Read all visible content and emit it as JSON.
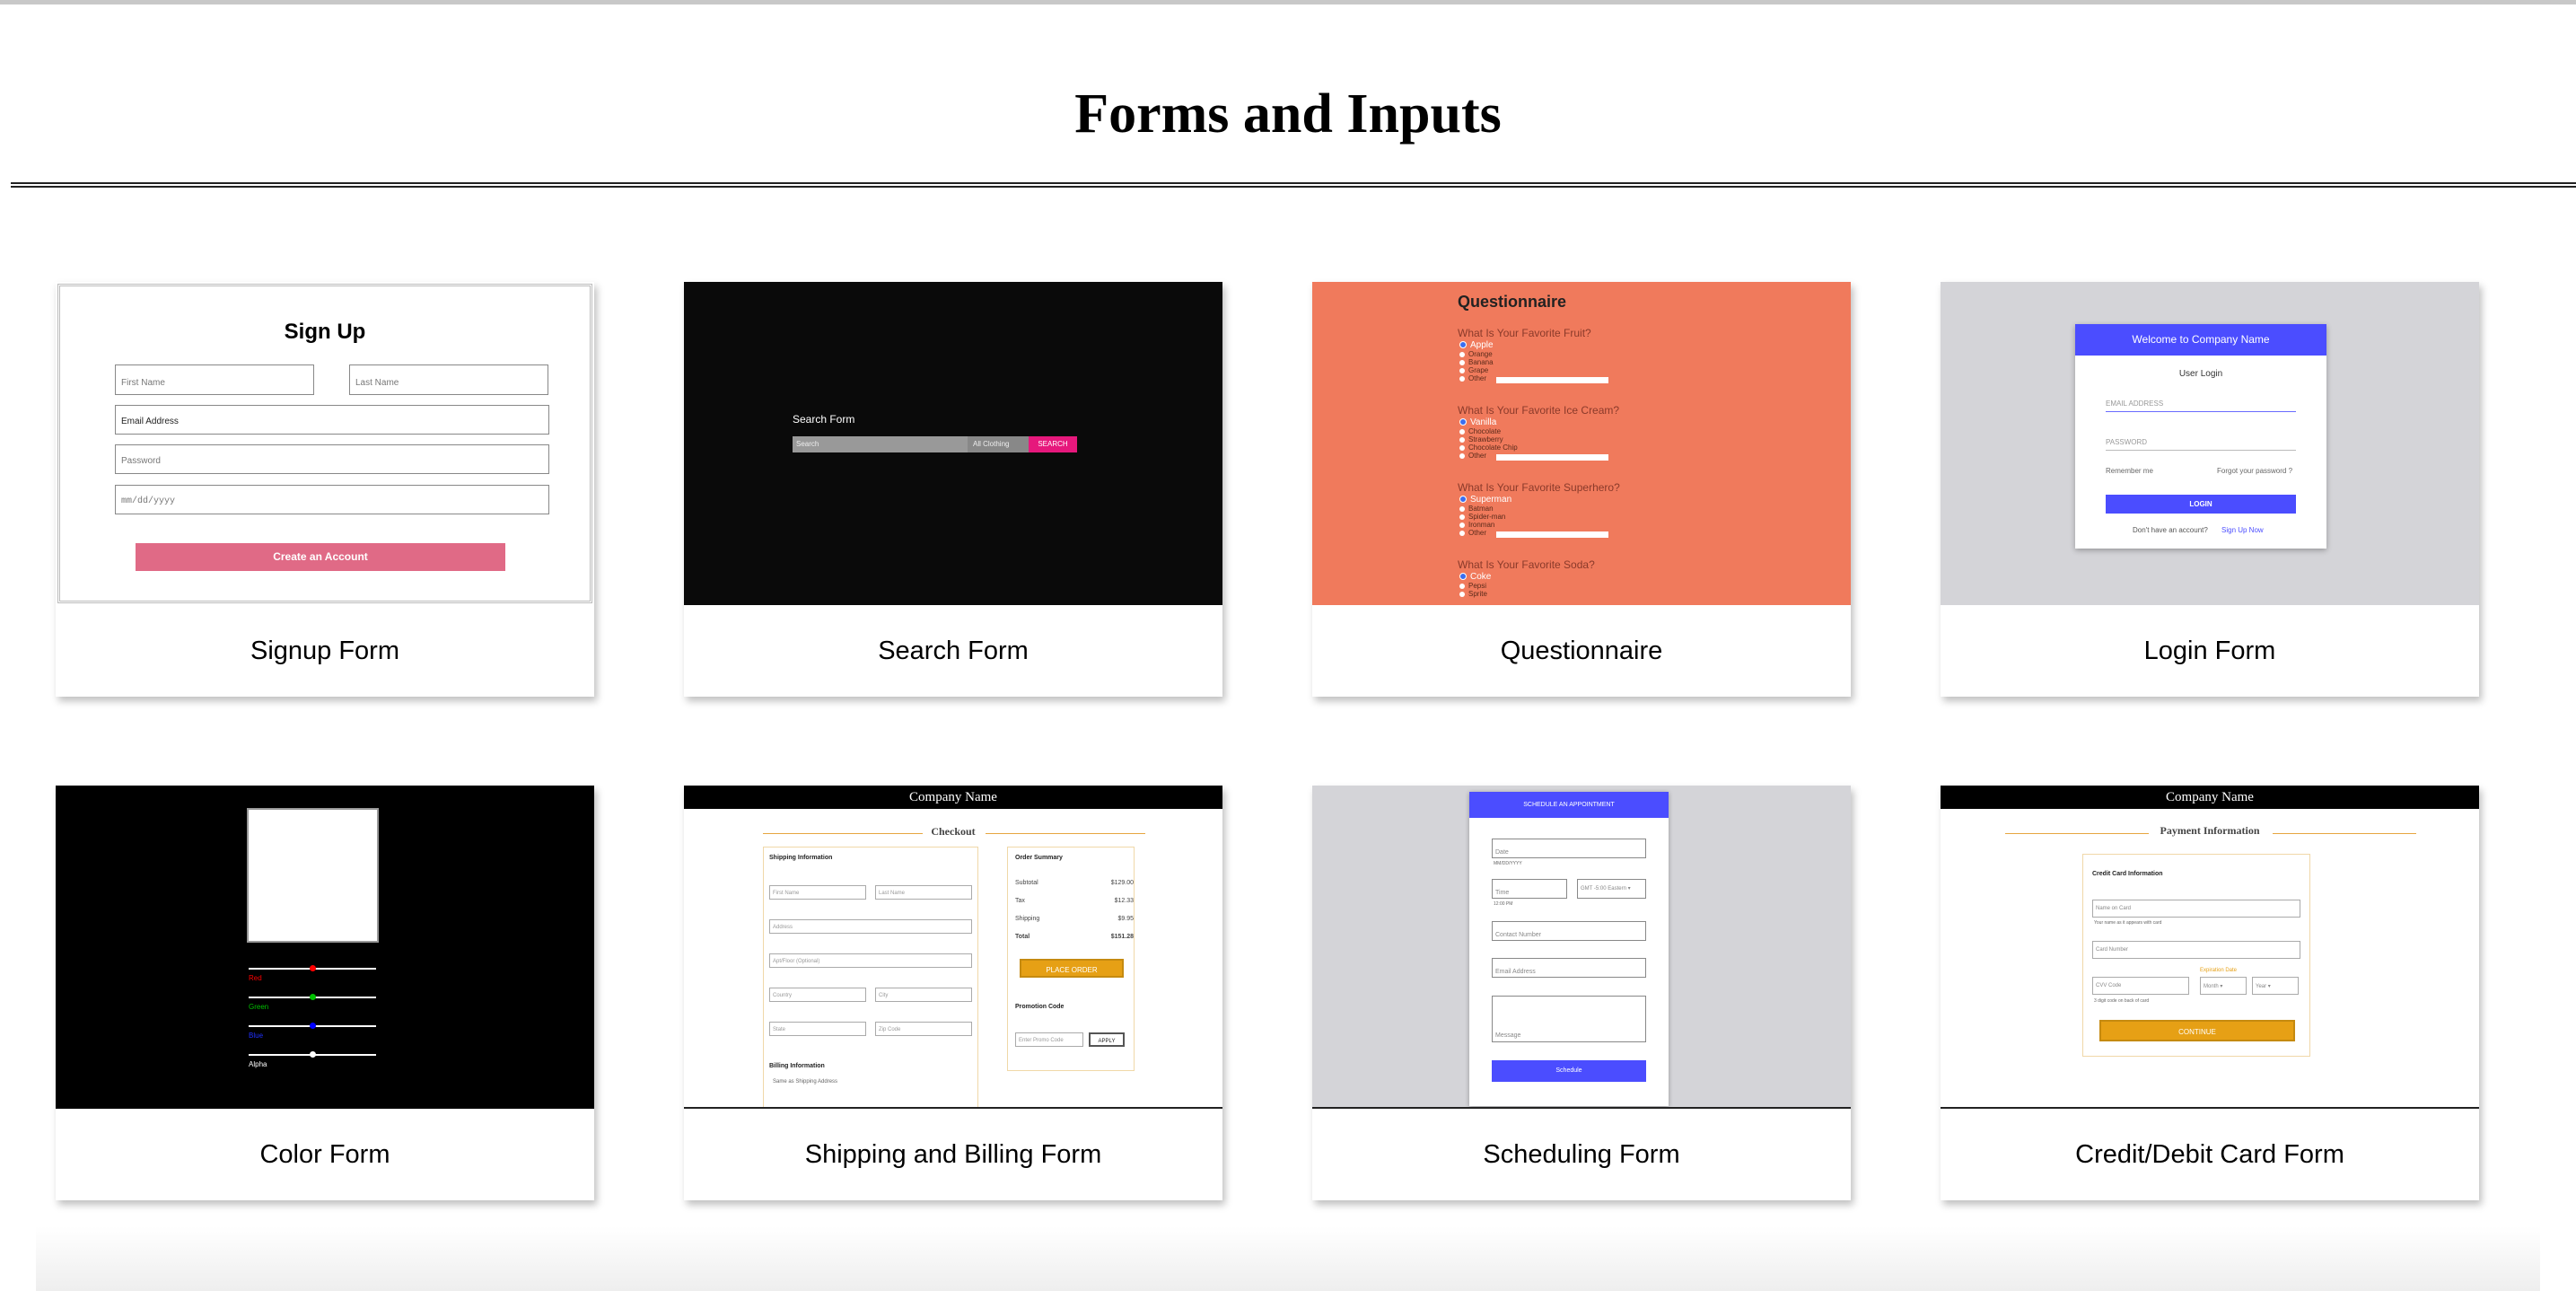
{
  "page": {
    "title": "Forms and Inputs"
  },
  "cards": [
    {
      "label": "Signup Form"
    },
    {
      "label": "Search Form"
    },
    {
      "label": "Questionnaire"
    },
    {
      "label": "Login Form"
    },
    {
      "label": "Color Form"
    },
    {
      "label": "Shipping and Billing Form"
    },
    {
      "label": "Scheduling Form"
    },
    {
      "label": "Credit/Debit Card Form"
    }
  ],
  "signup": {
    "title": "Sign Up",
    "first_name": "First Name",
    "last_name": "Last Name",
    "email": "Email Address",
    "password": "Password",
    "date": "mm/dd/yyyy",
    "button": "Create an Account"
  },
  "search": {
    "label": "Search Form",
    "input": "Search",
    "select": "All Clothing",
    "button": "SEARCH"
  },
  "questionnaire": {
    "title": "Questionnaire",
    "q1": "What Is Your Favorite Fruit?",
    "q1_opts": [
      "Apple",
      "Orange",
      "Banana",
      "Grape",
      "Other"
    ],
    "q2": "What Is Your Favorite Ice Cream?",
    "q2_opts": [
      "Vanilla",
      "Chocolate",
      "Strawberry",
      "Chocolate Chip",
      "Other"
    ],
    "q3": "What Is Your Favorite Superhero?",
    "q3_opts": [
      "Superman",
      "Batman",
      "Spider-man",
      "Ironman",
      "Other"
    ],
    "q4": "What Is Your Favorite Soda?",
    "q4_opts": [
      "Coke",
      "Pepsi",
      "Sprite"
    ]
  },
  "login": {
    "header": "Welcome to Company Name",
    "subtitle": "User Login",
    "email": "EMAIL ADDRESS",
    "password": "PASSWORD",
    "remember": "Remember me",
    "forgot": "Forgot your password ?",
    "button": "LOGIN",
    "no_account": "Don't have an account?",
    "signup_link": "Sign Up Now"
  },
  "color": {
    "sliders": [
      {
        "label": "Red",
        "color": "#ff0000",
        "value": 0.5
      },
      {
        "label": "Green",
        "color": "#00c000",
        "value": 0.5
      },
      {
        "label": "Blue",
        "color": "#0000ff",
        "value": 0.5
      },
      {
        "label": "Alpha",
        "color": "#ffffff",
        "value": 0.5
      }
    ]
  },
  "shipping": {
    "company": "Company Name",
    "heading": "Checkout",
    "shipping_info": "Shipping Information",
    "fields": [
      "First Name",
      "Last Name",
      "Address",
      "Apt/Floor (Optional)",
      "Country",
      "City",
      "State",
      "Zip Code"
    ],
    "billing_info": "Billing Information",
    "same_as": "Same as Shipping Address",
    "order_summary": "Order Summary",
    "rows": [
      {
        "label": "Subtotal",
        "value": "$129.00"
      },
      {
        "label": "Tax",
        "value": "$12.33"
      },
      {
        "label": "Shipping",
        "value": "$9.95"
      },
      {
        "label": "Total",
        "value": "$151.28"
      }
    ],
    "place_order": "PLACE ORDER",
    "promo": "Promotion Code",
    "promo_placeholder": "Enter Promo Code",
    "apply": "APPLY"
  },
  "scheduling": {
    "header": "SCHEDULE AN APPOINTMENT",
    "date": "Date",
    "date_hint": "MM/DD/YYYY",
    "time": "Time",
    "time_hint": "12:00 PM",
    "timezone": "GMT -5:00 Eastern",
    "contact": "Contact Number",
    "email": "Email Address",
    "message": "Message",
    "button": "Schedule"
  },
  "card_form": {
    "company": "Company Name",
    "heading": "Payment Information",
    "section": "Credit Card Information",
    "name": "Name on Card",
    "name_hint": "Your name as it appears with card",
    "number": "Card Number",
    "expiration": "Expiration Date",
    "cvv": "CVV Code",
    "cvv_hint": "3 digit code on back of card",
    "month": "Month",
    "year": "Year",
    "button": "CONTINUE"
  }
}
